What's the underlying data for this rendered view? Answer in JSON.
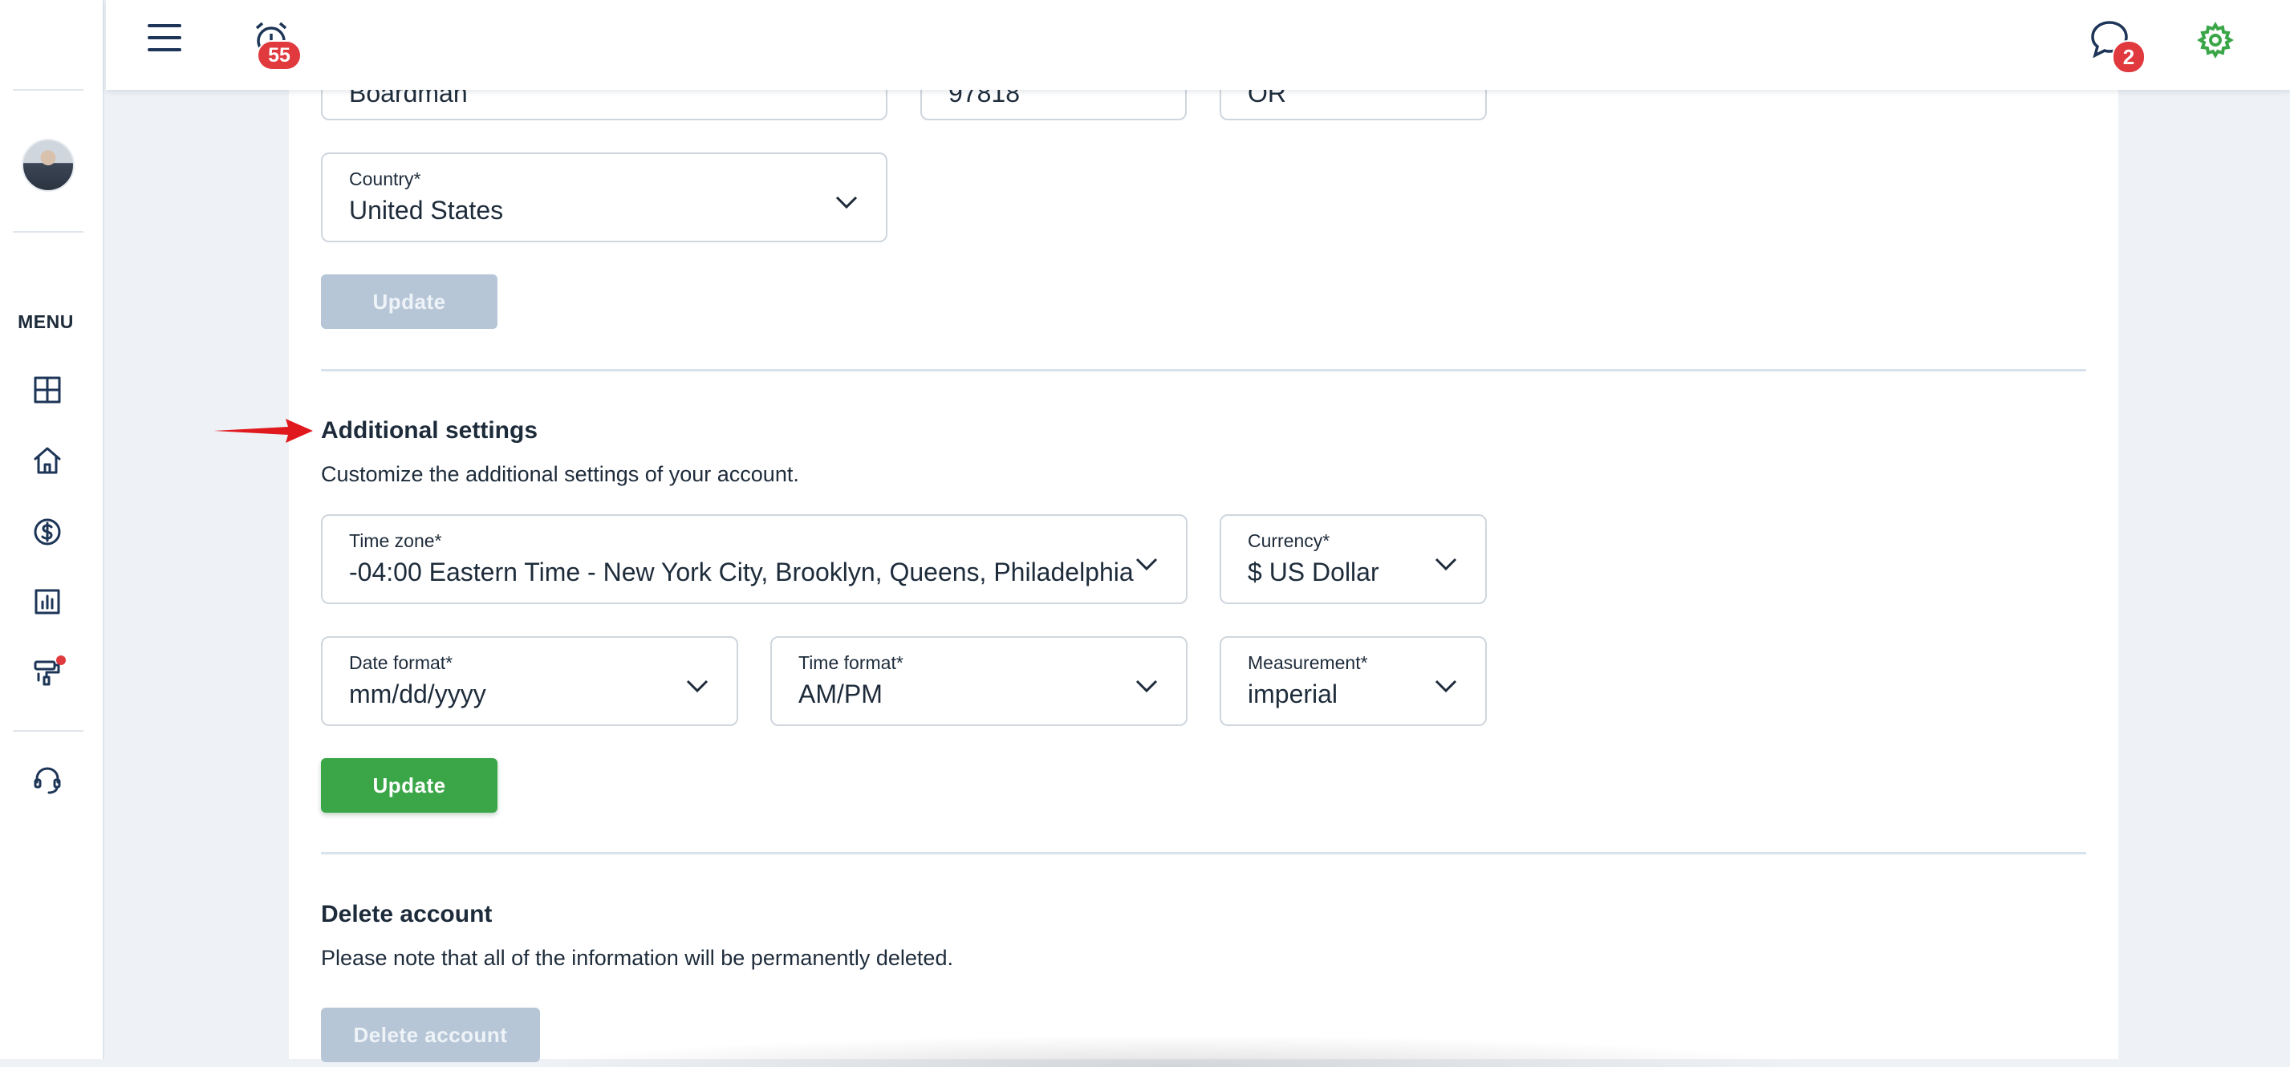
{
  "header": {
    "notifications_count": "55",
    "messages_count": "2"
  },
  "sidebar": {
    "menu_label": "MENU",
    "items": [
      {
        "icon": "dashboard-icon"
      },
      {
        "icon": "home-icon"
      },
      {
        "icon": "dollar-icon"
      },
      {
        "icon": "chart-icon"
      },
      {
        "icon": "paint-roller-icon",
        "has_dot": true
      },
      {
        "icon": "headset-icon"
      }
    ]
  },
  "address": {
    "city_value": "Boardman",
    "zip_value": "97818",
    "state_value": "OR",
    "country_label": "Country*",
    "country_value": "United States",
    "update_label": "Update"
  },
  "additional": {
    "title": "Additional settings",
    "description": "Customize the additional settings of your account.",
    "timezone_label": "Time zone*",
    "timezone_value": "-04:00 Eastern Time - New York City, Brooklyn, Queens, Philadelphia",
    "currency_label": "Currency*",
    "currency_value": "$ US Dollar",
    "date_format_label": "Date format*",
    "date_format_value": "mm/dd/yyyy",
    "time_format_label": "Time format*",
    "time_format_value": "AM/PM",
    "measurement_label": "Measurement*",
    "measurement_value": "imperial",
    "update_label": "Update"
  },
  "delete": {
    "title": "Delete account",
    "description": "Please note that all of the information will be permanently deleted.",
    "button_label": "Delete account"
  },
  "colors": {
    "accent_green": "#3aa648",
    "badge_red": "#e0393e",
    "disabled_button": "#b7c6d6",
    "annotation_arrow": "#e0191f"
  }
}
